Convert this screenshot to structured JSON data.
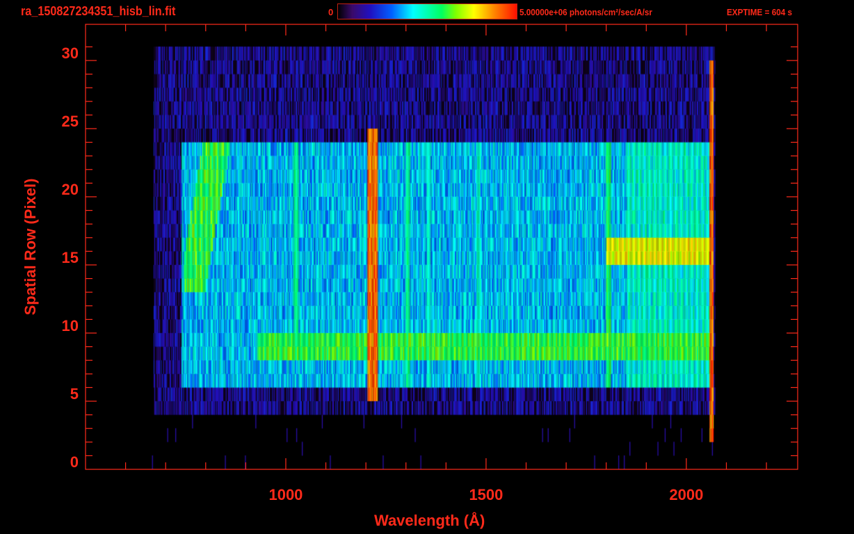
{
  "header": {
    "title": "ra_150827234351_hisb_lin.fit",
    "colorbar_min": "0",
    "colorbar_max_label": "5.00000e+06 photons/cm²/sec/A/sr",
    "exptime": "EXPTIME = 604 s"
  },
  "colors": {
    "axis": "#ff2a1a",
    "background": "#000000"
  },
  "chart_data": {
    "type": "heatmap",
    "title": "ra_150827234351_hisb_lin.fit",
    "xlabel": "Wavelength (Å)",
    "ylabel": "Spatial Row (Pixel)",
    "xlim": [
      500,
      2278
    ],
    "ylim": [
      -0.5,
      32
    ],
    "xticks": [
      "1000",
      "1500",
      "2000"
    ],
    "yticks": [
      "0",
      "5",
      "10",
      "15",
      "20",
      "25",
      "30"
    ],
    "colorscale": {
      "min": 0,
      "max": 5000000,
      "units": "photons/cm^2/sec/A/sr",
      "map": "rainbow"
    },
    "data_extent": {
      "wavelength": [
        660,
        2075
      ],
      "rows": [
        0,
        30
      ]
    },
    "features": [
      {
        "name": "background",
        "rows": [
          4,
          30
        ],
        "wavelength": [
          670,
          2070
        ],
        "level": 0.15
      },
      {
        "name": "illuminated slit",
        "rows": [
          6,
          23
        ],
        "wavelength": [
          740,
          2060
        ],
        "level": 0.38
      },
      {
        "name": "arc",
        "rows": [
          13,
          23
        ],
        "wavelength": [
          745,
          860
        ],
        "level": 0.6
      },
      {
        "name": "band rows 8-9",
        "rows": [
          8,
          9
        ],
        "wavelength": [
          930,
          2060
        ],
        "level": 0.62
      },
      {
        "name": "band rows 15-16",
        "rows": [
          15,
          16
        ],
        "wavelength": [
          1800,
          2060
        ],
        "level": 0.75
      },
      {
        "name": "line 1025",
        "rows": [
          9,
          23
        ],
        "wavelength": [
          1025
        ],
        "level": 0.55
      },
      {
        "name": "line 1216",
        "rows": [
          5,
          24
        ],
        "wavelength": [
          1216
        ],
        "level": 0.95
      },
      {
        "name": "line 1304",
        "rows": [
          6,
          23
        ],
        "wavelength": [
          1304
        ],
        "level": 0.55
      },
      {
        "name": "line 1356",
        "rows": [
          6,
          23
        ],
        "wavelength": [
          1356
        ],
        "level": 0.48
      },
      {
        "name": "line 1480",
        "rows": [
          6,
          23
        ],
        "wavelength": [
          1480
        ],
        "level": 0.5
      },
      {
        "name": "line 1805",
        "rows": [
          6,
          23
        ],
        "wavelength": [
          1805
        ],
        "level": 0.6
      },
      {
        "name": "edge 2062",
        "rows": [
          2,
          29
        ],
        "wavelength": [
          2062
        ],
        "level": 0.95
      }
    ]
  }
}
